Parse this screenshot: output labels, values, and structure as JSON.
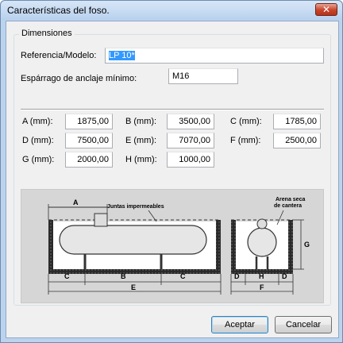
{
  "window": {
    "title": "Características del foso.",
    "close_label": "✕"
  },
  "group": {
    "legend": "Dimensiones"
  },
  "fields": {
    "referencia": {
      "label": "Referencia/Modelo:",
      "value": "LP 10*"
    },
    "esparrago": {
      "label": "Espárrago de anclaje mínimo:",
      "value": "M16"
    }
  },
  "dims": [
    {
      "label": "A (mm):",
      "value": "1875,00"
    },
    {
      "label": "B (mm):",
      "value": "3500,00"
    },
    {
      "label": "C (mm):",
      "value": "1785,00"
    },
    {
      "label": "D (mm):",
      "value": "7500,00"
    },
    {
      "label": "E (mm):",
      "value": "7070,00"
    },
    {
      "label": "F (mm):",
      "value": "2500,00"
    },
    {
      "label": "G (mm):",
      "value": "2000,00"
    },
    {
      "label": "H (mm):",
      "value": "1000,00"
    }
  ],
  "diagram": {
    "label_a": "A",
    "label_b": "B",
    "label_c": "C",
    "label_d": "D",
    "label_e": "E",
    "label_f": "F",
    "label_g": "G",
    "label_h": "H",
    "juntas": "Juntas impermeables",
    "arena_1": "Arena seca",
    "arena_2": "de cantera"
  },
  "buttons": {
    "accept": "Aceptar",
    "cancel": "Cancelar"
  },
  "colors": {
    "accent": "#3399ff",
    "diagram_bg": "#d6d6d6"
  }
}
